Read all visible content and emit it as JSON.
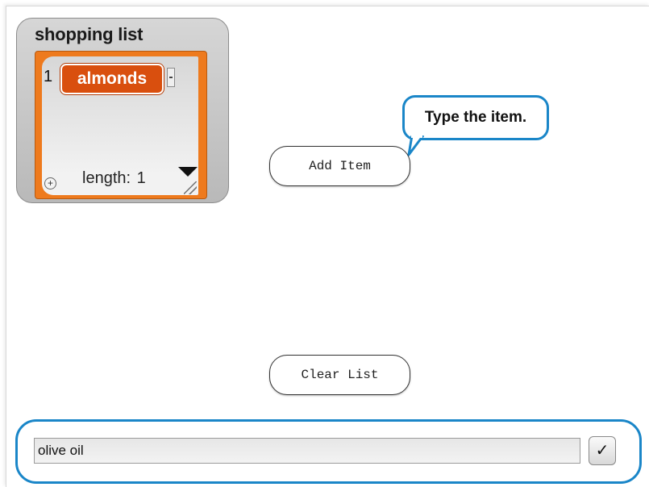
{
  "watcher": {
    "variable_name": "shopping list",
    "items": [
      {
        "index": "1",
        "value": "almonds"
      }
    ],
    "length_label": "length:",
    "length_value": "1"
  },
  "buttons": {
    "add_item": "Add Item",
    "clear_list": "Clear List"
  },
  "speech_bubble": {
    "text": "Type the item."
  },
  "ask_prompt": {
    "value": "olive oil",
    "confirm_icon": "✓"
  },
  "colors": {
    "list_frame": "#ee7a1d",
    "list_item": "#d94f0e",
    "bubble_border": "#1a86c8",
    "prompt_border": "#1a86c8"
  }
}
